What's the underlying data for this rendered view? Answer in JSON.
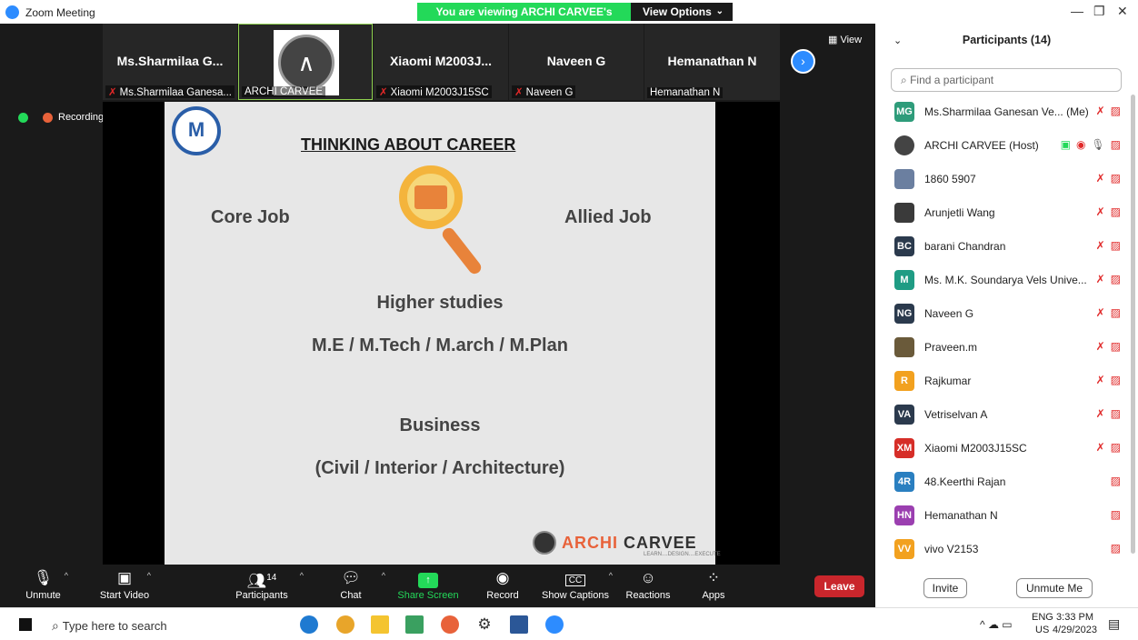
{
  "window": {
    "title": "Zoom Meeting"
  },
  "share_banner": "You are viewing ARCHI CARVEE's screen",
  "view_options": "View Options",
  "view_button": "View",
  "recording": "Recording",
  "thumbs": [
    {
      "name": "Ms.Sharmilaa  G...",
      "label": "Ms.Sharmilaa Ganesa..."
    },
    {
      "name": "",
      "label": "ARCHI CARVEE"
    },
    {
      "name": "Xiaomi  M2003J...",
      "label": "Xiaomi M2003J15SC"
    },
    {
      "name": "Naveen G",
      "label": "Naveen G"
    },
    {
      "name": "Hemanathan N",
      "label": "Hemanathan N"
    }
  ],
  "slide": {
    "title": "THINKING ABOUT CAREER",
    "core": "Core Job",
    "allied": "Allied Job",
    "higher": "Higher studies",
    "degrees": "M.E / M.Tech / M.arch / M.Plan",
    "business": "Business",
    "business_sub": "(Civil / Interior / Architecture)",
    "brand1": "ARCHI",
    "brand2": "CARVEE",
    "tagline": "LEARN....DESIGN....EXECUTE"
  },
  "toolbar": {
    "unmute": "Unmute",
    "start_video": "Start Video",
    "participants": "Participants",
    "participants_count": "14",
    "chat": "Chat",
    "share_screen": "Share Screen",
    "record": "Record",
    "captions": "Show Captions",
    "reactions": "Reactions",
    "apps": "Apps",
    "leave": "Leave"
  },
  "panel": {
    "title": "Participants (14)",
    "search_placeholder": "Find a participant",
    "invite": "Invite",
    "unmute_me": "Unmute Me",
    "participants": [
      {
        "initials": "MG",
        "color": "#2e9c7a",
        "name": "Ms.Sharmilaa Ganesan Ve... (Me)"
      },
      {
        "initials": "",
        "color": "#444444",
        "name": "ARCHI CARVEE (Host)"
      },
      {
        "initials": "",
        "color": "#6b7fa0",
        "name": "1860 5907"
      },
      {
        "initials": "",
        "color": "#3a3a3a",
        "name": "Arunjetli Wang"
      },
      {
        "initials": "BC",
        "color": "#2b3a4d",
        "name": "barani Chandran"
      },
      {
        "initials": "M",
        "color": "#1f9c84",
        "name": "Ms. M.K. Soundarya Vels Unive..."
      },
      {
        "initials": "NG",
        "color": "#2b3a4d",
        "name": "Naveen G"
      },
      {
        "initials": "",
        "color": "#6a5a3a",
        "name": "Praveen.m"
      },
      {
        "initials": "R",
        "color": "#f2a11f",
        "name": "Rajkumar"
      },
      {
        "initials": "VA",
        "color": "#2b3a4d",
        "name": "Vetriselvan A"
      },
      {
        "initials": "XM",
        "color": "#d62e28",
        "name": "Xiaomi M2003J15SC"
      },
      {
        "initials": "4R",
        "color": "#2a7fc0",
        "name": "48.Keerthi Rajan"
      },
      {
        "initials": "HN",
        "color": "#9b3fb0",
        "name": "Hemanathan N"
      },
      {
        "initials": "VV",
        "color": "#f2a11f",
        "name": "vivo V2153"
      }
    ]
  },
  "taskbar": {
    "search": "Type here to search",
    "lang": "ENG",
    "region": "US",
    "time": "3:33 PM",
    "date": "4/29/2023"
  }
}
